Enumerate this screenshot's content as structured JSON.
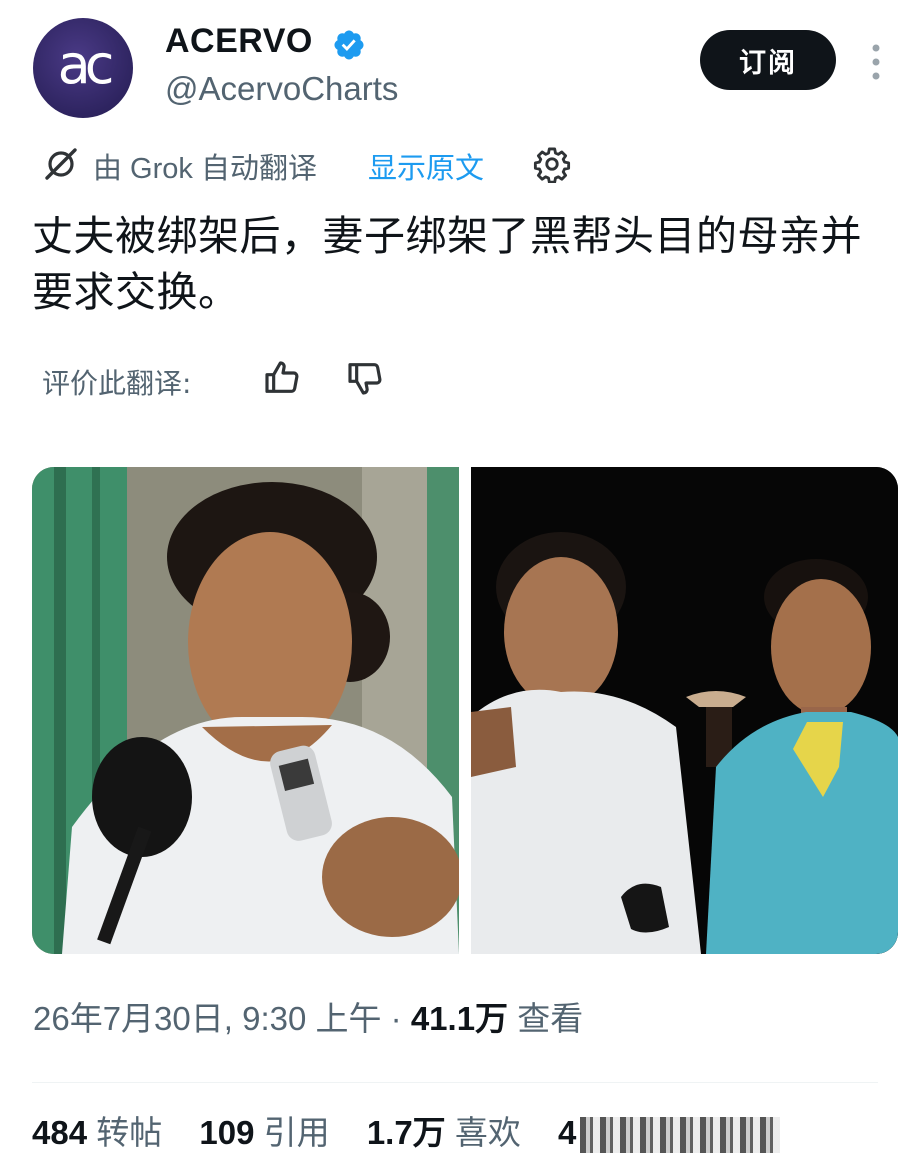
{
  "account": {
    "avatar_text": "ac",
    "display_name": "ACERVO",
    "handle": "@AcervoCharts",
    "subscribe_label": "订阅"
  },
  "translation": {
    "by_label": "由 Grok 自动翻译",
    "show_original": "显示原文",
    "rate_label": "评价此翻译:"
  },
  "tweet": {
    "text": "丈夫被绑架后，妻子绑架了黑帮头目的母亲并要求交换。"
  },
  "meta": {
    "timestamp": "26年7月30日, 9:30 上午 · ",
    "views_count": "41.1万",
    "views_label": " 查看"
  },
  "stats": {
    "reposts_count": "484",
    "reposts_label": " 转帖",
    "quotes_count": "109",
    "quotes_label": " 引用",
    "likes_count": "1.7万",
    "likes_label": " 喜欢",
    "bookmarks_count_partial": "4"
  },
  "icons": {
    "verified": "verified-badge-icon",
    "more": "more-vertical-icon",
    "grok": "grok-icon",
    "settings": "gear-icon",
    "thumb_up": "thumbs-up-icon",
    "thumb_down": "thumbs-down-icon"
  },
  "colors": {
    "accent": "#1d9bf0",
    "text": "#0f1419",
    "muted": "#536471",
    "button": "#0f1419"
  }
}
